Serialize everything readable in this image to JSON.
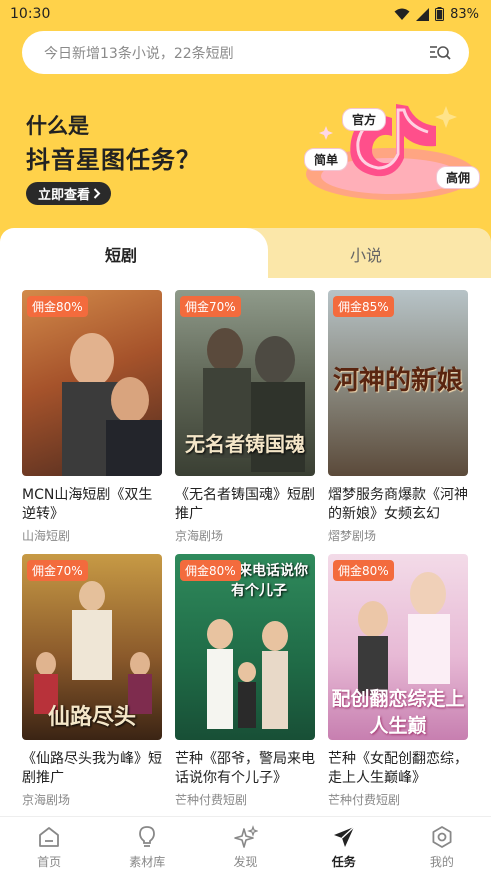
{
  "status_bar": {
    "time": "10:30",
    "battery": "83%"
  },
  "search": {
    "placeholder": "今日新增13条小说，22条短剧"
  },
  "banner": {
    "line1": "什么是",
    "line2": "抖音星图任务？",
    "cta": "立即查看",
    "tags": [
      "官方",
      "简单",
      "高佣"
    ]
  },
  "tabs": [
    {
      "label": "短剧",
      "active": true
    },
    {
      "label": "小说",
      "active": false
    }
  ],
  "cards": [
    {
      "badge": "佣金80%",
      "title": "MCN山海短剧《双生逆转》",
      "source": "山海短剧",
      "poster_text": ""
    },
    {
      "badge": "佣金70%",
      "title": "《无名者铸国魂》短剧推广",
      "source": "京海剧场",
      "poster_text": "无名者铸国魂"
    },
    {
      "badge": "佣金85%",
      "title": "熠梦服务商爆款《河神的新娘》女频玄幻",
      "source": "熠梦剧场",
      "poster_text": "河神的新娘"
    },
    {
      "badge": "佣金70%",
      "title": "《仙路尽头我为峰》短剧推广",
      "source": "京海剧场",
      "poster_text": "仙路尽头"
    },
    {
      "badge": "佣金80%",
      "title": "芒种《邵爷，警局来电话说你有个儿子》",
      "source": "芒种付费短剧",
      "poster_text": "警局来电话说你有个儿子"
    },
    {
      "badge": "佣金80%",
      "title": "芒种《女配创翻恋综，走上人生巅峰》",
      "source": "芒种付费短剧",
      "poster_text": "配创翻恋综走上人生巅"
    }
  ],
  "bottom_nav": [
    {
      "label": "首页",
      "icon": "home-icon",
      "active": false
    },
    {
      "label": "素材库",
      "icon": "lightbulb-icon",
      "active": false
    },
    {
      "label": "发现",
      "icon": "sparkle-icon",
      "active": false
    },
    {
      "label": "任务",
      "icon": "paper-plane-icon",
      "active": true
    },
    {
      "label": "我的",
      "icon": "settings-icon",
      "active": false
    }
  ],
  "colors": {
    "header_yellow": "#ffd24a",
    "badge_orange": "#f36b3d",
    "inactive_tab": "#fbe7a9"
  }
}
